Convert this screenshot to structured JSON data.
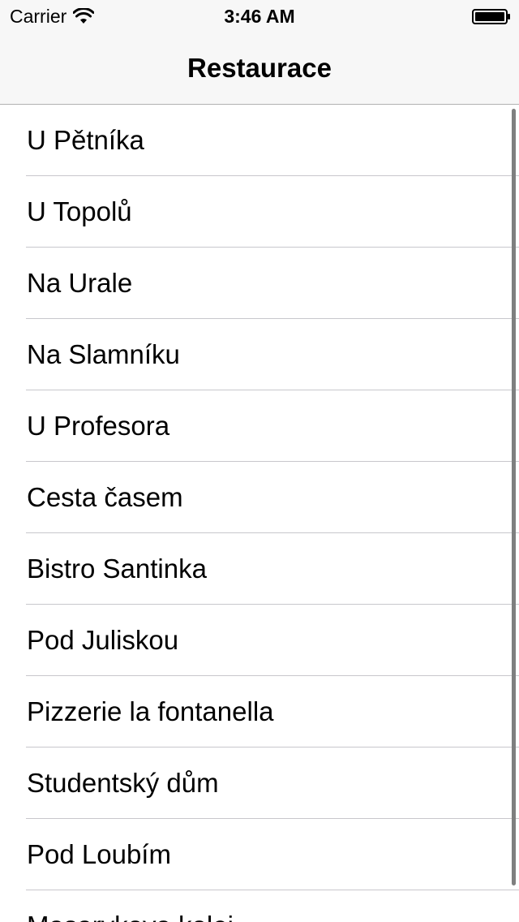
{
  "status_bar": {
    "carrier": "Carrier",
    "time": "3:46 AM",
    "wifi_icon": "wifi-icon",
    "battery_icon": "battery-icon"
  },
  "nav": {
    "title": "Restaurace"
  },
  "restaurants": [
    "U Pětníka",
    "U Topolů",
    "Na Urale",
    "Na Slamníku",
    "U Profesora",
    "Cesta časem",
    "Bistro Santinka",
    "Pod Juliskou",
    "Pizzerie la fontanella",
    "Studentský dům",
    "Pod Loubím",
    "Masarykova kolej"
  ]
}
